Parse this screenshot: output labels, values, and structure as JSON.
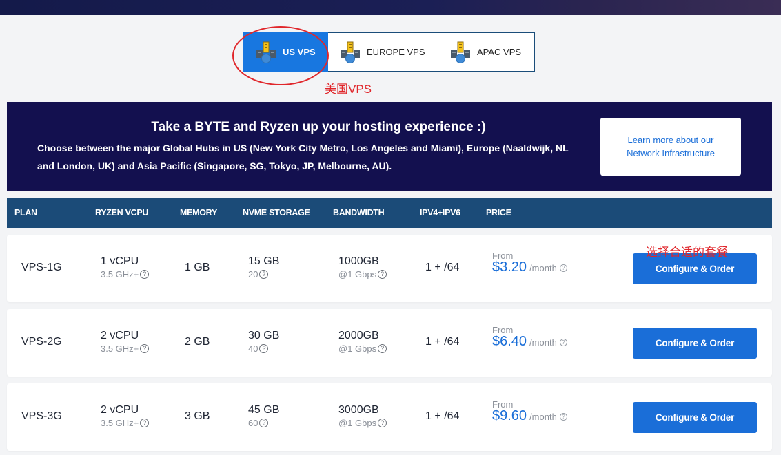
{
  "tabs": [
    {
      "label": "US VPS",
      "active": true,
      "icon": "server-icon"
    },
    {
      "label": "EUROPE VPS",
      "active": false,
      "icon": "server-icon"
    },
    {
      "label": "APAC VPS",
      "active": false,
      "icon": "server-icon"
    }
  ],
  "annotations": {
    "us_vps": "美国VPS",
    "choose_plan": "选择合适的套餐",
    "color": "#e0262b"
  },
  "banner": {
    "title": "Take a BYTE and Ryzen up your hosting experience :)",
    "description": "Choose between the major Global Hubs in US (New York City Metro, Los Angeles and Miami), Europe (Naaldwijk, NL and London, UK) and Asia Pacific (Singapore, SG, Tokyo, JP, Melbourne, AU).",
    "learn_more": "Learn more about our Network Infrastructure"
  },
  "table": {
    "headers": [
      "PLAN",
      "RYZEN VCPU",
      "MEMORY",
      "NVME STORAGE",
      "BANDWIDTH",
      "IPV4+IPV6",
      "PRICE"
    ],
    "rows": [
      {
        "plan": "VPS-1G",
        "vcpu": "1 vCPU",
        "vcpu_sub": "3.5 GHz+",
        "memory": "1 GB",
        "storage": "15 GB",
        "storage_sub": "20",
        "bandwidth": "1000GB",
        "bandwidth_sub": "@1 Gbps",
        "ip": "1 + /64",
        "from": "From",
        "price": "$3.20",
        "per": "/month",
        "button": "Configure & Order"
      },
      {
        "plan": "VPS-2G",
        "vcpu": "2 vCPU",
        "vcpu_sub": "3.5 GHz+",
        "memory": "2 GB",
        "storage": "30 GB",
        "storage_sub": "40",
        "bandwidth": "2000GB",
        "bandwidth_sub": "@1 Gbps",
        "ip": "1 + /64",
        "from": "From",
        "price": "$6.40",
        "per": "/month",
        "button": "Configure & Order"
      },
      {
        "plan": "VPS-3G",
        "vcpu": "2 vCPU",
        "vcpu_sub": "3.5 GHz+",
        "memory": "3 GB",
        "storage": "45 GB",
        "storage_sub": "60",
        "bandwidth": "3000GB",
        "bandwidth_sub": "@1 Gbps",
        "ip": "1 + /64",
        "from": "From",
        "price": "$9.60",
        "per": "/month",
        "button": "Configure & Order"
      }
    ]
  },
  "help_icon": "question-mark-circle-icon",
  "colors": {
    "accent": "#1a6ed8",
    "active_tab": "#1877e0",
    "banner_bg": "#13104f",
    "table_header_bg": "#1b4b78"
  }
}
